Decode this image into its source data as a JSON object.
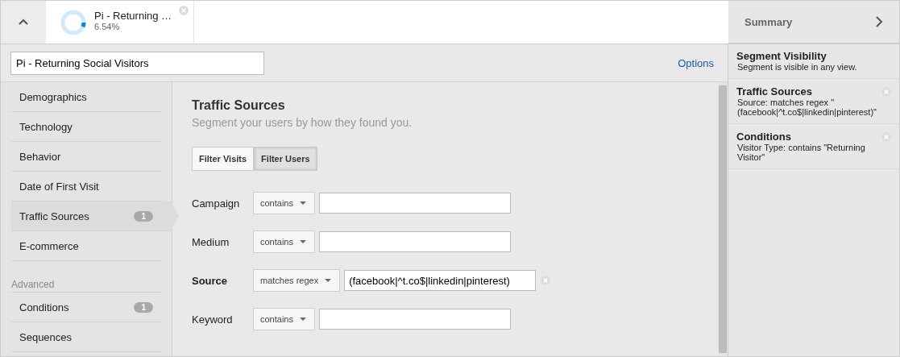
{
  "segment_bar": {
    "segments": [
      {
        "name": "Pi - Returning …",
        "share": "6.54%",
        "level": 0.0654
      }
    ]
  },
  "editor": {
    "name_value": "Pi - Returning Social Visitors",
    "options_link": "Options"
  },
  "sidebar": {
    "groups": [
      {
        "items": [
          {
            "label": "Demographics",
            "selected": false
          },
          {
            "label": "Technology",
            "selected": false
          },
          {
            "label": "Behavior",
            "selected": false
          },
          {
            "label": "Date of First Visit",
            "selected": false
          },
          {
            "label": "Traffic Sources",
            "selected": true,
            "badge": "1"
          },
          {
            "label": "E-commerce",
            "selected": false
          }
        ]
      },
      {
        "heading": "Advanced",
        "items": [
          {
            "label": "Conditions",
            "selected": false,
            "badge": "1"
          },
          {
            "label": "Sequences",
            "selected": false
          }
        ]
      }
    ]
  },
  "content": {
    "title": "Traffic Sources",
    "subtitle": "Segment your users by how they found you.",
    "filter_tabs": [
      {
        "label": "Filter Visits",
        "selected": false
      },
      {
        "label": "Filter Users",
        "selected": true
      }
    ],
    "rows": [
      {
        "label": "Campaign",
        "operator": "contains",
        "value": "",
        "active": false
      },
      {
        "label": "Medium",
        "operator": "contains",
        "value": "",
        "active": false
      },
      {
        "label": "Source",
        "operator": "matches regex",
        "value": "(facebook|^t.co$|linkedin|pinterest)",
        "active": true
      },
      {
        "label": "Keyword",
        "operator": "contains",
        "value": "",
        "active": false
      }
    ]
  },
  "summary": {
    "title": "Summary",
    "items": [
      {
        "title": "Segment Visibility",
        "text": "Segment is visible in any view.",
        "removable": false
      },
      {
        "title": "Traffic Sources",
        "text": "Source: matches regex \"(facebook|^t.co$|linkedin|pinterest)\"",
        "removable": true
      },
      {
        "title": "Conditions",
        "text": "Visitor Type: contains \"Returning Visitor\"",
        "removable": true
      }
    ]
  }
}
